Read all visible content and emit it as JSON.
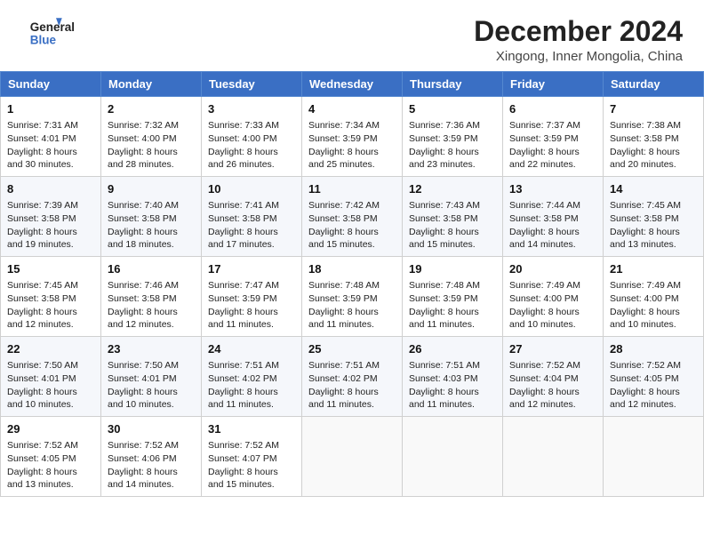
{
  "header": {
    "logo_line1": "General",
    "logo_line2": "Blue",
    "month": "December 2024",
    "location": "Xingong, Inner Mongolia, China"
  },
  "weekdays": [
    "Sunday",
    "Monday",
    "Tuesday",
    "Wednesday",
    "Thursday",
    "Friday",
    "Saturday"
  ],
  "weeks": [
    [
      {
        "day": 1,
        "lines": [
          "Sunrise: 7:31 AM",
          "Sunset: 4:01 PM",
          "Daylight: 8 hours",
          "and 30 minutes."
        ]
      },
      {
        "day": 2,
        "lines": [
          "Sunrise: 7:32 AM",
          "Sunset: 4:00 PM",
          "Daylight: 8 hours",
          "and 28 minutes."
        ]
      },
      {
        "day": 3,
        "lines": [
          "Sunrise: 7:33 AM",
          "Sunset: 4:00 PM",
          "Daylight: 8 hours",
          "and 26 minutes."
        ]
      },
      {
        "day": 4,
        "lines": [
          "Sunrise: 7:34 AM",
          "Sunset: 3:59 PM",
          "Daylight: 8 hours",
          "and 25 minutes."
        ]
      },
      {
        "day": 5,
        "lines": [
          "Sunrise: 7:36 AM",
          "Sunset: 3:59 PM",
          "Daylight: 8 hours",
          "and 23 minutes."
        ]
      },
      {
        "day": 6,
        "lines": [
          "Sunrise: 7:37 AM",
          "Sunset: 3:59 PM",
          "Daylight: 8 hours",
          "and 22 minutes."
        ]
      },
      {
        "day": 7,
        "lines": [
          "Sunrise: 7:38 AM",
          "Sunset: 3:58 PM",
          "Daylight: 8 hours",
          "and 20 minutes."
        ]
      }
    ],
    [
      {
        "day": 8,
        "lines": [
          "Sunrise: 7:39 AM",
          "Sunset: 3:58 PM",
          "Daylight: 8 hours",
          "and 19 minutes."
        ]
      },
      {
        "day": 9,
        "lines": [
          "Sunrise: 7:40 AM",
          "Sunset: 3:58 PM",
          "Daylight: 8 hours",
          "and 18 minutes."
        ]
      },
      {
        "day": 10,
        "lines": [
          "Sunrise: 7:41 AM",
          "Sunset: 3:58 PM",
          "Daylight: 8 hours",
          "and 17 minutes."
        ]
      },
      {
        "day": 11,
        "lines": [
          "Sunrise: 7:42 AM",
          "Sunset: 3:58 PM",
          "Daylight: 8 hours",
          "and 15 minutes."
        ]
      },
      {
        "day": 12,
        "lines": [
          "Sunrise: 7:43 AM",
          "Sunset: 3:58 PM",
          "Daylight: 8 hours",
          "and 15 minutes."
        ]
      },
      {
        "day": 13,
        "lines": [
          "Sunrise: 7:44 AM",
          "Sunset: 3:58 PM",
          "Daylight: 8 hours",
          "and 14 minutes."
        ]
      },
      {
        "day": 14,
        "lines": [
          "Sunrise: 7:45 AM",
          "Sunset: 3:58 PM",
          "Daylight: 8 hours",
          "and 13 minutes."
        ]
      }
    ],
    [
      {
        "day": 15,
        "lines": [
          "Sunrise: 7:45 AM",
          "Sunset: 3:58 PM",
          "Daylight: 8 hours",
          "and 12 minutes."
        ]
      },
      {
        "day": 16,
        "lines": [
          "Sunrise: 7:46 AM",
          "Sunset: 3:58 PM",
          "Daylight: 8 hours",
          "and 12 minutes."
        ]
      },
      {
        "day": 17,
        "lines": [
          "Sunrise: 7:47 AM",
          "Sunset: 3:59 PM",
          "Daylight: 8 hours",
          "and 11 minutes."
        ]
      },
      {
        "day": 18,
        "lines": [
          "Sunrise: 7:48 AM",
          "Sunset: 3:59 PM",
          "Daylight: 8 hours",
          "and 11 minutes."
        ]
      },
      {
        "day": 19,
        "lines": [
          "Sunrise: 7:48 AM",
          "Sunset: 3:59 PM",
          "Daylight: 8 hours",
          "and 11 minutes."
        ]
      },
      {
        "day": 20,
        "lines": [
          "Sunrise: 7:49 AM",
          "Sunset: 4:00 PM",
          "Daylight: 8 hours",
          "and 10 minutes."
        ]
      },
      {
        "day": 21,
        "lines": [
          "Sunrise: 7:49 AM",
          "Sunset: 4:00 PM",
          "Daylight: 8 hours",
          "and 10 minutes."
        ]
      }
    ],
    [
      {
        "day": 22,
        "lines": [
          "Sunrise: 7:50 AM",
          "Sunset: 4:01 PM",
          "Daylight: 8 hours",
          "and 10 minutes."
        ]
      },
      {
        "day": 23,
        "lines": [
          "Sunrise: 7:50 AM",
          "Sunset: 4:01 PM",
          "Daylight: 8 hours",
          "and 10 minutes."
        ]
      },
      {
        "day": 24,
        "lines": [
          "Sunrise: 7:51 AM",
          "Sunset: 4:02 PM",
          "Daylight: 8 hours",
          "and 11 minutes."
        ]
      },
      {
        "day": 25,
        "lines": [
          "Sunrise: 7:51 AM",
          "Sunset: 4:02 PM",
          "Daylight: 8 hours",
          "and 11 minutes."
        ]
      },
      {
        "day": 26,
        "lines": [
          "Sunrise: 7:51 AM",
          "Sunset: 4:03 PM",
          "Daylight: 8 hours",
          "and 11 minutes."
        ]
      },
      {
        "day": 27,
        "lines": [
          "Sunrise: 7:52 AM",
          "Sunset: 4:04 PM",
          "Daylight: 8 hours",
          "and 12 minutes."
        ]
      },
      {
        "day": 28,
        "lines": [
          "Sunrise: 7:52 AM",
          "Sunset: 4:05 PM",
          "Daylight: 8 hours",
          "and 12 minutes."
        ]
      }
    ],
    [
      {
        "day": 29,
        "lines": [
          "Sunrise: 7:52 AM",
          "Sunset: 4:05 PM",
          "Daylight: 8 hours",
          "and 13 minutes."
        ]
      },
      {
        "day": 30,
        "lines": [
          "Sunrise: 7:52 AM",
          "Sunset: 4:06 PM",
          "Daylight: 8 hours",
          "and 14 minutes."
        ]
      },
      {
        "day": 31,
        "lines": [
          "Sunrise: 7:52 AM",
          "Sunset: 4:07 PM",
          "Daylight: 8 hours",
          "and 15 minutes."
        ]
      },
      null,
      null,
      null,
      null
    ]
  ]
}
